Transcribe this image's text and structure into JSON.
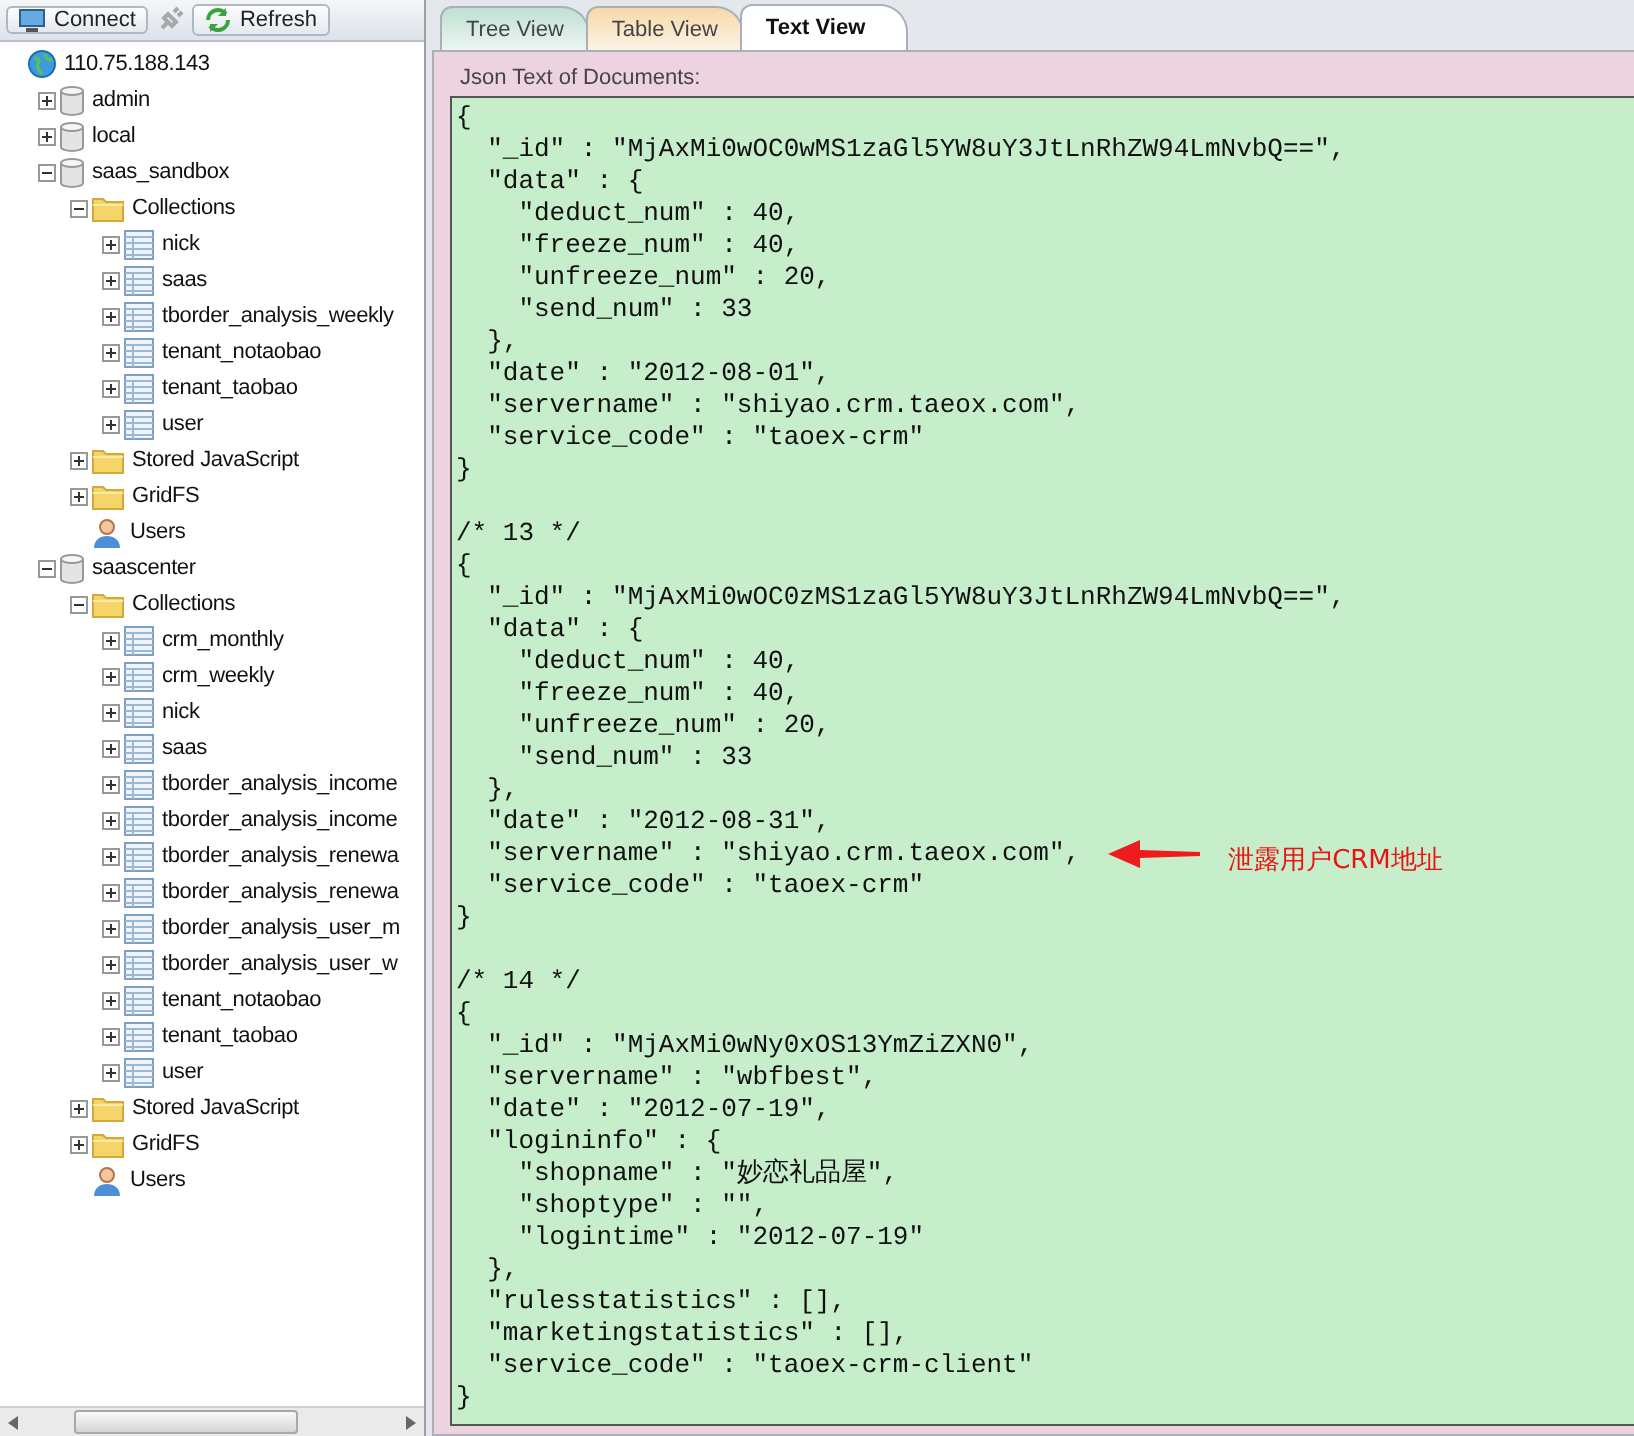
{
  "toolbar": {
    "buttons": [
      {
        "label": "Connect",
        "kind": "connect"
      },
      {
        "label": "Refresh",
        "kind": "refresh"
      }
    ]
  },
  "tree": [
    {
      "label": "110.75.188.143",
      "kind": "server",
      "children": [
        {
          "label": "admin",
          "kind": "database",
          "expanded": false
        },
        {
          "label": "local",
          "kind": "database",
          "expanded": false
        },
        {
          "label": "saas_sandbox",
          "kind": "database",
          "expanded": true,
          "children": [
            {
              "label": "Collections",
              "kind": "folder",
              "expanded": true,
              "children": [
                {
                  "label": "nick",
                  "kind": "collection",
                  "expanded": false
                },
                {
                  "label": "saas",
                  "kind": "collection",
                  "expanded": false
                },
                {
                  "label": "tborder_analysis_weekly",
                  "kind": "collection",
                  "expanded": false
                },
                {
                  "label": "tenant_notaobao",
                  "kind": "collection",
                  "expanded": false
                },
                {
                  "label": "tenant_taobao",
                  "kind": "collection",
                  "expanded": false
                },
                {
                  "label": "user",
                  "kind": "collection",
                  "expanded": false
                }
              ]
            },
            {
              "label": "Stored JavaScript",
              "kind": "folder",
              "expanded": false
            },
            {
              "label": "GridFS",
              "kind": "folder",
              "expanded": false
            },
            {
              "label": "Users",
              "kind": "users"
            }
          ]
        },
        {
          "label": "saascenter",
          "kind": "database",
          "expanded": true,
          "children": [
            {
              "label": "Collections",
              "kind": "folder",
              "expanded": true,
              "children": [
                {
                  "label": "crm_monthly",
                  "kind": "collection",
                  "expanded": false
                },
                {
                  "label": "crm_weekly",
                  "kind": "collection",
                  "expanded": false
                },
                {
                  "label": "nick",
                  "kind": "collection",
                  "expanded": false
                },
                {
                  "label": "saas",
                  "kind": "collection",
                  "expanded": false
                },
                {
                  "label": "tborder_analysis_income",
                  "kind": "collection",
                  "expanded": false
                },
                {
                  "label": "tborder_analysis_income",
                  "kind": "collection",
                  "expanded": false
                },
                {
                  "label": "tborder_analysis_renewa",
                  "kind": "collection",
                  "expanded": false
                },
                {
                  "label": "tborder_analysis_renewa",
                  "kind": "collection",
                  "expanded": false
                },
                {
                  "label": "tborder_analysis_user_m",
                  "kind": "collection",
                  "expanded": false
                },
                {
                  "label": "tborder_analysis_user_w",
                  "kind": "collection",
                  "expanded": false
                },
                {
                  "label": "tenant_notaobao",
                  "kind": "collection",
                  "expanded": false
                },
                {
                  "label": "tenant_taobao",
                  "kind": "collection",
                  "expanded": false
                },
                {
                  "label": "user",
                  "kind": "collection",
                  "expanded": false
                }
              ]
            },
            {
              "label": "Stored JavaScript",
              "kind": "folder",
              "expanded": false
            },
            {
              "label": "GridFS",
              "kind": "folder",
              "expanded": false
            },
            {
              "label": "Users",
              "kind": "users"
            }
          ]
        }
      ]
    }
  ],
  "tabs": [
    {
      "label": "Tree View",
      "selected": false,
      "color": "#bfe0d2"
    },
    {
      "label": "Table View",
      "selected": false,
      "color": "#f6d9a8"
    },
    {
      "label": "Text View",
      "selected": true,
      "color": "#ffffff"
    }
  ],
  "panel": {
    "label": "Json Text of Documents:"
  },
  "documents": [
    {
      "lines": [
        {
          "text": "{"
        },
        {
          "text": "  \"_id\" : \"MjAxMi0wOC0wMS1zaGl5YW8uY3JtLnRhZW94LmNvbQ==\","
        },
        {
          "text": "  \"data\" : {"
        },
        {
          "text": "    \"deduct_num\" : 40,"
        },
        {
          "text": "    \"freeze_num\" : 40,"
        },
        {
          "text": "    \"unfreeze_num\" : 20,"
        },
        {
          "text": "    \"send_num\" : 33"
        },
        {
          "text": "  },"
        },
        {
          "text": "  \"date\" : \"2012-08-01\","
        },
        {
          "text": "  \"servername\" : \"shiyao.crm.taeox.com\","
        },
        {
          "text": "  \"service_code\" : \"taoex-crm\""
        },
        {
          "text": "}"
        }
      ]
    },
    {
      "comment": "/* 13 */",
      "lines": [
        {
          "text": "{"
        },
        {
          "text": "  \"_id\" : \"MjAxMi0wOC0zMS1zaGl5YW8uY3JtLnRhZW94LmNvbQ==\","
        },
        {
          "text": "  \"data\" : {"
        },
        {
          "text": "    \"deduct_num\" : 40,"
        },
        {
          "text": "    \"freeze_num\" : 40,"
        },
        {
          "text": "    \"unfreeze_num\" : 20,"
        },
        {
          "text": "    \"send_num\" : 33"
        },
        {
          "text": "  },"
        },
        {
          "text": "  \"date\" : \"2012-08-31\","
        },
        {
          "text": "  \"servername\" : \"shiyao.crm.taeox.com\",",
          "annotation": "泄露用户CRM地址"
        },
        {
          "text": "  \"service_code\" : \"taoex-crm\""
        },
        {
          "text": "}"
        }
      ]
    },
    {
      "comment": "/* 14 */",
      "lines": [
        {
          "text": "{"
        },
        {
          "text": "  \"_id\" : \"MjAxMi0wNy0xOS13YmZiZXN0\","
        },
        {
          "text": "  \"servername\" : \"wbfbest\","
        },
        {
          "text": "  \"date\" : \"2012-07-19\","
        },
        {
          "text": "  \"logininfo\" : {"
        },
        {
          "text": "    \"shopname\" : \"妙恋礼品屋\","
        },
        {
          "text": "    \"shoptype\" : \"\","
        },
        {
          "text": "    \"logintime\" : \"2012-07-19\""
        },
        {
          "text": "  },"
        },
        {
          "text": "  \"rulesstatistics\" : [],"
        },
        {
          "text": "  \"marketingstatistics\" : [],"
        },
        {
          "text": "  \"service_code\" : \"taoex-crm-client\""
        },
        {
          "text": "}"
        }
      ]
    }
  ]
}
